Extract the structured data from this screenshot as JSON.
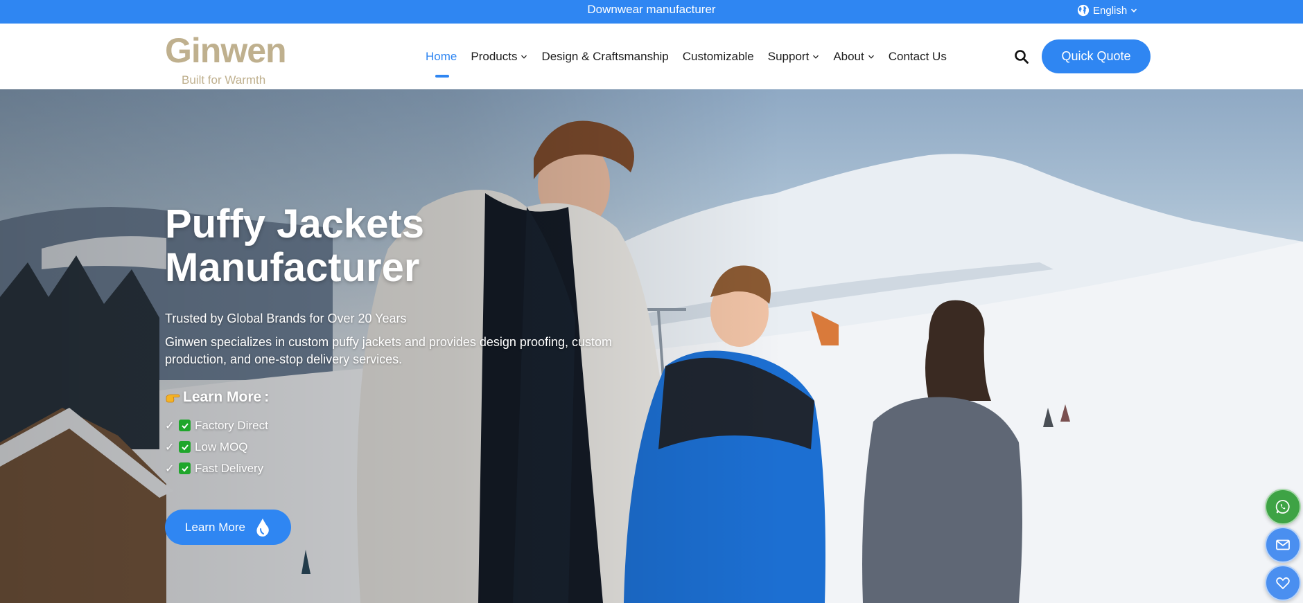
{
  "topbar": {
    "tagline": "Downwear manufacturer",
    "language": {
      "label": "English",
      "icon": "globe-icon"
    }
  },
  "header": {
    "logo": {
      "brand": "Ginwen",
      "slogan": "Built for Warmth",
      "color": "#bfb08e"
    },
    "nav": [
      {
        "label": "Home",
        "active": true,
        "dropdown": false
      },
      {
        "label": "Products",
        "active": false,
        "dropdown": true
      },
      {
        "label": "Design & Craftsmanship",
        "active": false,
        "dropdown": false
      },
      {
        "label": "Customizable",
        "active": false,
        "dropdown": false
      },
      {
        "label": "Support",
        "active": false,
        "dropdown": true
      },
      {
        "label": "About",
        "active": false,
        "dropdown": true
      },
      {
        "label": "Contact Us",
        "active": false,
        "dropdown": false
      }
    ],
    "search_icon": "search-icon",
    "quote_button": "Quick Quote"
  },
  "hero": {
    "title_line1": "Puffy Jackets",
    "title_line2": "Manufacturer",
    "subtitle": "Trusted by Global Brands for Over 20 Years",
    "description": "Ginwen specializes in custom puffy jackets and provides design proofing, custom production, and one-stop delivery services.",
    "learn_heading": "Learn More",
    "learn_heading_suffix": ":",
    "features": [
      {
        "tick": "✓",
        "label": "Factory Direct"
      },
      {
        "tick": "✓",
        "label": "Low MOQ"
      },
      {
        "tick": "✓",
        "label": "Fast Delivery"
      }
    ],
    "button": "Learn More"
  },
  "floating_contacts": [
    {
      "icon": "whatsapp-icon",
      "color": "#3ea345"
    },
    {
      "icon": "mail-icon",
      "color": "#4a8ff0"
    },
    {
      "icon": "heart-icon",
      "color": "#4a8ff0"
    }
  ],
  "colors": {
    "accent": "#2f86f2",
    "text": "#1d1d1d",
    "feature_check": "#1fa62b"
  }
}
